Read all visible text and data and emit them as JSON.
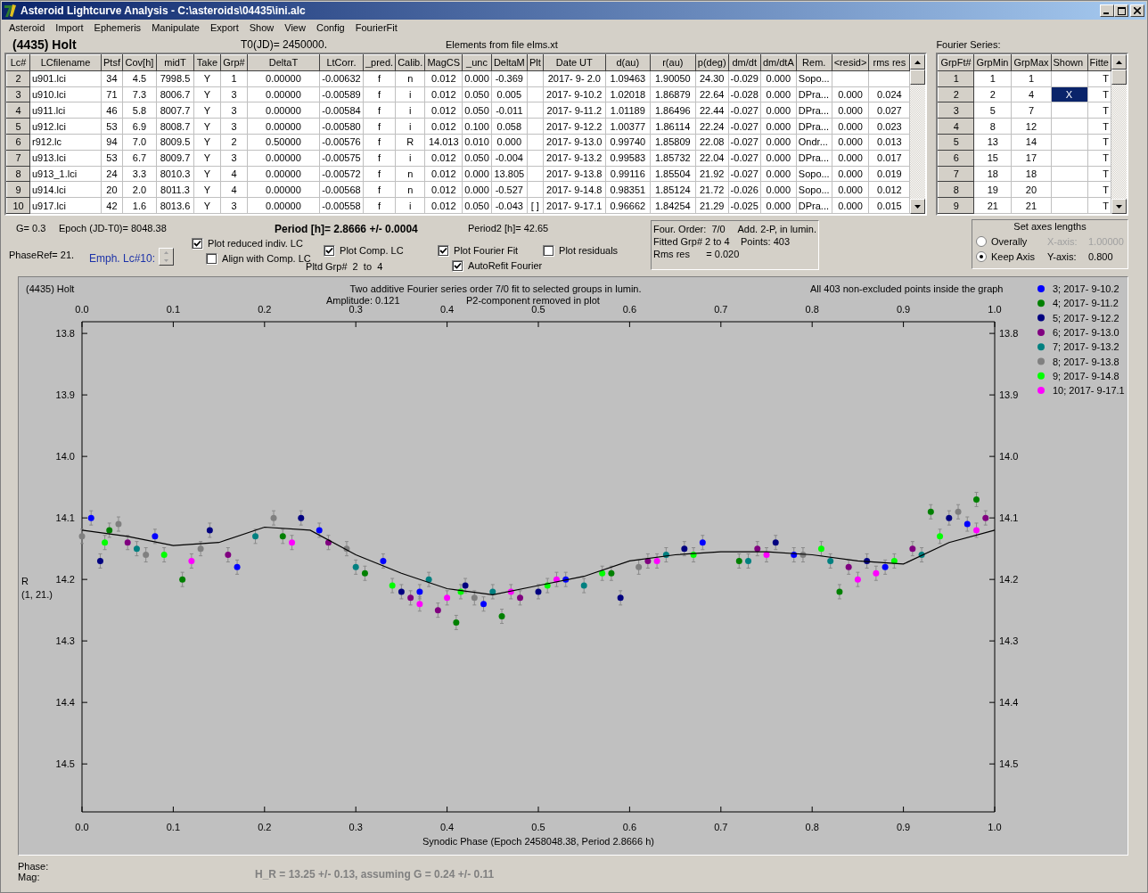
{
  "window": {
    "title": "Asteroid Lightcurve Analysis - C:\\asteroids\\04435\\ini.alc"
  },
  "menu": [
    "Asteroid",
    "Import",
    "Ephemeris",
    "Manipulate",
    "Export",
    "Show",
    "View",
    "Config",
    "FourierFit"
  ],
  "object_name": "(4435) Holt",
  "t0": "T0(JD)= 2450000.",
  "elements_note": "Elements from file elms.xt",
  "lc_table": {
    "columns": [
      "Lc#",
      "LCfilename",
      "Ptsf",
      "Cov[h]",
      "midT",
      "Take",
      "Grp#",
      "DeltaT",
      "LtCorr.",
      "_pred.",
      "Calib.",
      "MagCS",
      "_unc",
      "DeltaM",
      "Plt",
      "Date UT",
      "d(au)",
      "r(au)",
      "p(deg)",
      "dm/dt",
      "dm/dtA",
      "Rem.",
      "<resid>",
      "rms res"
    ],
    "rows": [
      {
        "cells": [
          "2",
          "u901.lci",
          "34",
          "4.5",
          "7998.5",
          "Y",
          "1",
          "0.00000",
          "-0.00632",
          "f",
          "n",
          "0.012",
          "0.000",
          "-0.369",
          null,
          "2017- 9- 2.0",
          "1.09463",
          "1.90050",
          "24.30",
          "-0.029",
          "0.000",
          "Sopo...",
          null,
          null
        ]
      },
      {
        "cells": [
          "3",
          "u910.lci",
          "71",
          "7.3",
          "8006.7",
          "Y",
          "3",
          "0.00000",
          "-0.00589",
          "f",
          "i",
          "0.012",
          "0.050",
          "0.005",
          null,
          "2017- 9-10.2",
          "1.02018",
          "1.86879",
          "22.64",
          "-0.028",
          "0.000",
          "DPra...",
          "0.000",
          "0.024"
        ]
      },
      {
        "cells": [
          "4",
          "u911.lci",
          "46",
          "5.8",
          "8007.7",
          "Y",
          "3",
          "0.00000",
          "-0.00584",
          "f",
          "i",
          "0.012",
          "0.050",
          "-0.011",
          null,
          "2017- 9-11.2",
          "1.01189",
          "1.86496",
          "22.44",
          "-0.027",
          "0.000",
          "DPra...",
          "0.000",
          "0.027"
        ]
      },
      {
        "cells": [
          "5",
          "u912.lci",
          "53",
          "6.9",
          "8008.7",
          "Y",
          "3",
          "0.00000",
          "-0.00580",
          "f",
          "i",
          "0.012",
          "0.100",
          "0.058",
          null,
          "2017- 9-12.2",
          "1.00377",
          "1.86114",
          "22.24",
          "-0.027",
          "0.000",
          "DPra...",
          "0.000",
          "0.023"
        ]
      },
      {
        "cells": [
          "6",
          "r912.lc",
          "94",
          "7.0",
          "8009.5",
          "Y",
          "2",
          "0.50000",
          "-0.00576",
          "f",
          "R",
          "14.013",
          "0.010",
          "0.000",
          null,
          "2017- 9-13.0",
          "0.99740",
          "1.85809",
          "22.08",
          "-0.027",
          "0.000",
          "Ondr...",
          "0.000",
          "0.013"
        ]
      },
      {
        "cells": [
          "7",
          "u913.lci",
          "53",
          "6.7",
          "8009.7",
          "Y",
          "3",
          "0.00000",
          "-0.00575",
          "f",
          "i",
          "0.012",
          "0.050",
          "-0.004",
          null,
          "2017- 9-13.2",
          "0.99583",
          "1.85732",
          "22.04",
          "-0.027",
          "0.000",
          "DPra...",
          "0.000",
          "0.017"
        ]
      },
      {
        "cells": [
          "8",
          "u913_1.lci",
          "24",
          "3.3",
          "8010.3",
          "Y",
          "4",
          "0.00000",
          "-0.00572",
          "f",
          "n",
          "0.012",
          "0.000",
          "13.805",
          null,
          "2017- 9-13.8",
          "0.99116",
          "1.85504",
          "21.92",
          "-0.027",
          "0.000",
          "Sopo...",
          "0.000",
          "0.019"
        ]
      },
      {
        "cells": [
          "9",
          "u914.lci",
          "20",
          "2.0",
          "8011.3",
          "Y",
          "4",
          "0.00000",
          "-0.00568",
          "f",
          "n",
          "0.012",
          "0.000",
          "-0.527",
          null,
          "2017- 9-14.8",
          "0.98351",
          "1.85124",
          "21.72",
          "-0.026",
          "0.000",
          "Sopo...",
          "0.000",
          "0.012"
        ]
      },
      {
        "cells": [
          "10",
          "u917.lci",
          "42",
          "1.6",
          "8013.6",
          "Y",
          "3",
          "0.00000",
          "-0.00558",
          "f",
          "i",
          "0.012",
          "0.050",
          "-0.043",
          "[ ]",
          "2017- 9-17.1",
          "0.96662",
          "1.84254",
          "21.29",
          "-0.025",
          "0.000",
          "DPra...",
          "0.000",
          "0.015"
        ]
      }
    ]
  },
  "fourier": {
    "label": "Fourier Series:",
    "columns": [
      "GrpFt#",
      "GrpMin",
      "GrpMax",
      "Shown",
      "Fitte"
    ],
    "rows": [
      {
        "n": "1",
        "min": "1",
        "max": "1",
        "fitted": "T",
        "selected": false
      },
      {
        "n": "2",
        "min": "2",
        "max": "4",
        "shown": "X",
        "fitted": "T",
        "selected": true
      },
      {
        "n": "3",
        "min": "5",
        "max": "7",
        "fitted": "T",
        "selected": false
      },
      {
        "n": "4",
        "min": "8",
        "max": "12",
        "fitted": "T",
        "selected": false
      },
      {
        "n": "5",
        "min": "13",
        "max": "14",
        "fitted": "T",
        "selected": false
      },
      {
        "n": "6",
        "min": "15",
        "max": "17",
        "fitted": "T",
        "selected": false
      },
      {
        "n": "7",
        "min": "18",
        "max": "18",
        "fitted": "T",
        "selected": false
      },
      {
        "n": "8",
        "min": "19",
        "max": "20",
        "fitted": "T",
        "selected": false
      },
      {
        "n": "9",
        "min": "21",
        "max": "21",
        "fitted": "T",
        "selected": false
      }
    ]
  },
  "params": {
    "g": "G= 0.3",
    "epoch": "Epoch (JD-T0)= 8048.38",
    "period": "Period [h]= 2.8666 +/- 0.0004",
    "period2": "Period2 [h]= 42.65",
    "phase_ref": "PhaseRef= 21.",
    "emph": "Emph. Lc#10:"
  },
  "plot_columns": [
    [
      {
        "kind": "checkbox",
        "label": "Plot reduced indiv. LC",
        "checked": true
      },
      {
        "kind": "checkbox",
        "label": "Align with Comp. LC",
        "checked": false
      }
    ],
    [
      {
        "kind": "checkbox",
        "label": "Plot Comp. LC",
        "checked": true
      },
      {
        "kind": "text",
        "label": "Pltd Grp#  2  to  4"
      }
    ],
    [
      {
        "kind": "checkbox",
        "label": "Plot Fourier Fit",
        "checked": true
      },
      {
        "kind": "checkbox",
        "label": "AutoRefit Fourier",
        "checked": true
      }
    ],
    [
      {
        "kind": "checkbox",
        "label": "Plot residuals",
        "checked": false
      }
    ]
  ],
  "fit_info": [
    [
      "Four. Order:  7/0",
      "Add. 2-P, in lumin."
    ],
    [
      "Fitted Grp# 2 to 4",
      "Points: 403"
    ],
    [
      "Rms res      = 0.020"
    ]
  ],
  "axes": {
    "title": "Set axes lengths",
    "options": [
      {
        "label": "Overally",
        "selected": false
      },
      {
        "label": "Keep Axis",
        "selected": true
      }
    ],
    "fields": [
      {
        "label": "X-axis:",
        "value": "1.00000",
        "disabled": true
      },
      {
        "label": "Y-axis:",
        "value": "0.800",
        "disabled": false
      }
    ]
  },
  "panel": {
    "object": "(4435) Holt",
    "title": "Two additive Fourier series order 7/0 fit to selected groups in lumin.",
    "amplitude": "Amplitude: 0.121",
    "p2_note": "P2-component removed in plot",
    "points_note": "All 403 non-excluded points inside the graph",
    "y_axis_name": "R",
    "y_axis_note": "(1, 21.)",
    "top_axis_labels": [
      "0.0",
      "0.1",
      "0.2",
      "0.3",
      "0.4",
      "0.5",
      "0.6",
      "0.7",
      "0.8",
      "0.9",
      "1.0"
    ],
    "right_axis_labels": [
      "13.8",
      "13.9",
      "14.0",
      "14.1",
      "14.2",
      "14.3",
      "14.4",
      "14.5"
    ],
    "chart_data": {
      "type": "scatter",
      "legend": "upper right",
      "xlabel": "Synodic Phase (Epoch 2458048.38, Period 2.8666 h)",
      "xlim": [
        0,
        1
      ],
      "ylim": [
        14.578,
        13.781
      ],
      "xticks": [
        {
          "value": 0,
          "label": "0.0"
        },
        {
          "value": 0.1,
          "label": "0.1"
        },
        {
          "value": 0.2,
          "label": "0.2"
        },
        {
          "value": 0.3,
          "label": "0.3"
        },
        {
          "value": 0.4,
          "label": "0.4"
        },
        {
          "value": 0.5,
          "label": "0.5"
        },
        {
          "value": 0.6,
          "label": "0.6"
        },
        {
          "value": 0.7,
          "label": "0.7"
        },
        {
          "value": 0.8,
          "label": "0.8"
        },
        {
          "value": 0.9,
          "label": "0.9"
        },
        {
          "value": 1,
          "label": "1.0"
        }
      ],
      "yticks": [
        {
          "value": 13.8,
          "label": "13.8"
        },
        {
          "value": 13.9,
          "label": "13.9"
        },
        {
          "value": 14,
          "label": "14.0"
        },
        {
          "value": 14.1,
          "label": "14.1"
        },
        {
          "value": 14.2,
          "label": "14.2"
        },
        {
          "value": 14.3,
          "label": "14.3"
        },
        {
          "value": 14.4,
          "label": "14.4"
        },
        {
          "value": 14.5,
          "label": "14.5"
        }
      ],
      "series": [
        {
          "name": "3; 2017- 9-10.2",
          "color": "#0000ff",
          "x": [
            0.01,
            0.08,
            0.17,
            0.26,
            0.33,
            0.37,
            0.44,
            0.53,
            0.68,
            0.78,
            0.88,
            0.97
          ],
          "values": [
            14.1,
            14.13,
            14.18,
            14.12,
            14.17,
            14.22,
            14.24,
            14.2,
            14.14,
            14.16,
            14.18,
            14.11
          ]
        },
        {
          "name": "4; 2017- 9-11.2",
          "color": "#008000",
          "x": [
            0.03,
            0.11,
            0.22,
            0.31,
            0.41,
            0.46,
            0.58,
            0.72,
            0.83,
            0.93,
            0.98
          ],
          "values": [
            14.12,
            14.2,
            14.13,
            14.19,
            14.27,
            14.26,
            14.19,
            14.17,
            14.22,
            14.09,
            14.07
          ]
        },
        {
          "name": "5; 2017- 9-12.2",
          "color": "#000080",
          "x": [
            0.02,
            0.14,
            0.24,
            0.35,
            0.42,
            0.5,
            0.59,
            0.66,
            0.76,
            0.86,
            0.95
          ],
          "values": [
            14.17,
            14.12,
            14.1,
            14.22,
            14.21,
            14.22,
            14.23,
            14.15,
            14.14,
            14.17,
            14.1
          ]
        },
        {
          "name": "6; 2017- 9-13.0",
          "color": "#800080",
          "x": [
            0.05,
            0.16,
            0.27,
            0.36,
            0.39,
            0.48,
            0.62,
            0.74,
            0.84,
            0.91,
            0.99
          ],
          "values": [
            14.14,
            14.16,
            14.14,
            14.23,
            14.25,
            14.23,
            14.17,
            14.15,
            14.18,
            14.15,
            14.1
          ]
        },
        {
          "name": "7; 2017- 9-13.2",
          "color": "#008080",
          "x": [
            0.06,
            0.19,
            0.3,
            0.38,
            0.45,
            0.55,
            0.64,
            0.73,
            0.82,
            0.92
          ],
          "values": [
            14.15,
            14.13,
            14.18,
            14.2,
            14.22,
            14.21,
            14.16,
            14.17,
            14.17,
            14.16
          ]
        },
        {
          "name": "8; 2017- 9-13.8",
          "color": "#808080",
          "x": [
            0.0,
            0.04,
            0.07,
            0.13,
            0.21,
            0.29,
            0.43,
            0.61,
            0.79,
            0.96
          ],
          "values": [
            14.13,
            14.11,
            14.16,
            14.15,
            14.1,
            14.15,
            14.23,
            14.18,
            14.16,
            14.09
          ]
        },
        {
          "name": "9; 2017- 9-14.8",
          "color": "#00ff00",
          "x": [
            0.025,
            0.09,
            0.34,
            0.415,
            0.51,
            0.57,
            0.67,
            0.81,
            0.89,
            0.94
          ],
          "values": [
            14.14,
            14.16,
            14.21,
            14.22,
            14.21,
            14.19,
            14.16,
            14.15,
            14.17,
            14.13
          ]
        },
        {
          "name": "10; 2017- 9-17.1",
          "color": "#ff00ff",
          "x": [
            0.12,
            0.23,
            0.37,
            0.4,
            0.47,
            0.52,
            0.63,
            0.75,
            0.85,
            0.87,
            0.98
          ],
          "values": [
            14.17,
            14.14,
            14.24,
            14.23,
            14.22,
            14.2,
            14.17,
            14.16,
            14.2,
            14.19,
            14.12
          ]
        },
        {
          "type": "line",
          "color": "#000000",
          "x": [
            0,
            0.05,
            0.1,
            0.15,
            0.2,
            0.25,
            0.3,
            0.35,
            0.4,
            0.45,
            0.5,
            0.55,
            0.6,
            0.65,
            0.7,
            0.75,
            0.8,
            0.85,
            0.9,
            0.95,
            1
          ],
          "values": [
            14.12,
            14.13,
            14.145,
            14.14,
            14.115,
            14.12,
            14.16,
            14.19,
            14.215,
            14.225,
            14.21,
            14.195,
            14.17,
            14.16,
            14.155,
            14.155,
            14.16,
            14.17,
            14.175,
            14.14,
            14.12
          ]
        }
      ]
    }
  },
  "status": {
    "phase": "Phase:",
    "mag": "Mag:",
    "hr": "H_R = 13.25 +/- 0.13, assuming G = 0.24 +/- 0.11"
  }
}
